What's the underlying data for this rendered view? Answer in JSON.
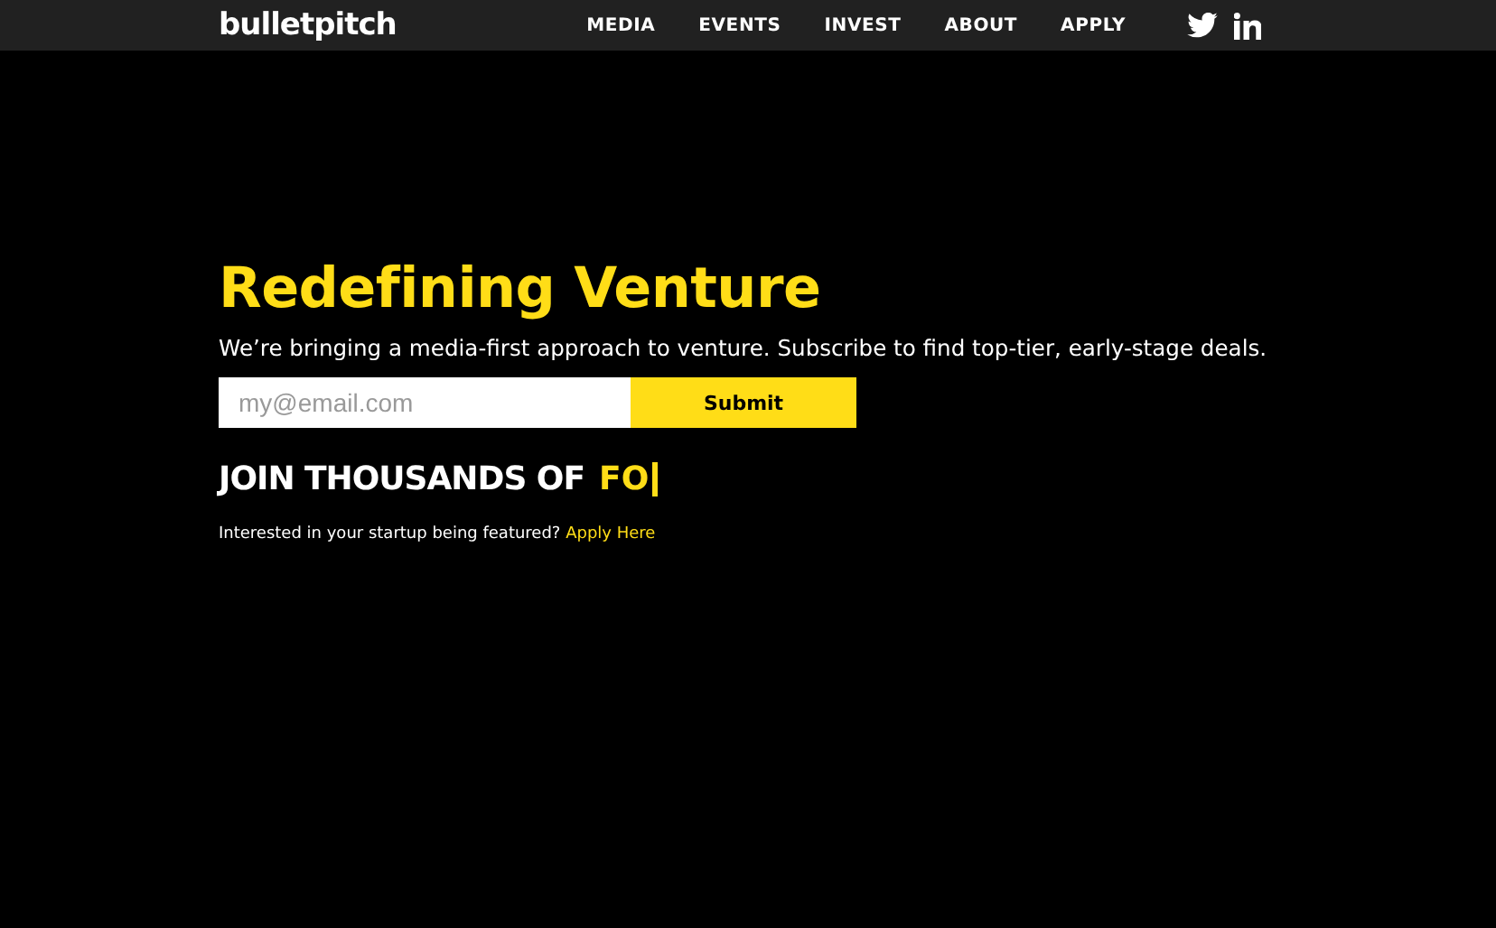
{
  "header": {
    "logo": "bulletpitch",
    "nav": [
      "MEDIA",
      "EVENTS",
      "INVEST",
      "ABOUT",
      "APPLY"
    ],
    "social": [
      {
        "kind": "twitter"
      },
      {
        "kind": "linkedin"
      }
    ]
  },
  "hero": {
    "title": "Redefining Venture",
    "subtitle": "We’re bringing a media-first approach to venture. Subscribe to find top-tier, early-stage deals.",
    "email": {
      "placeholder": "my@email.com"
    },
    "submit": "Submit",
    "tagline": "JOIN THOUSANDS OF",
    "typed": "FO",
    "note": "Interested in your startup being featured?",
    "note_link": "Apply Here"
  }
}
